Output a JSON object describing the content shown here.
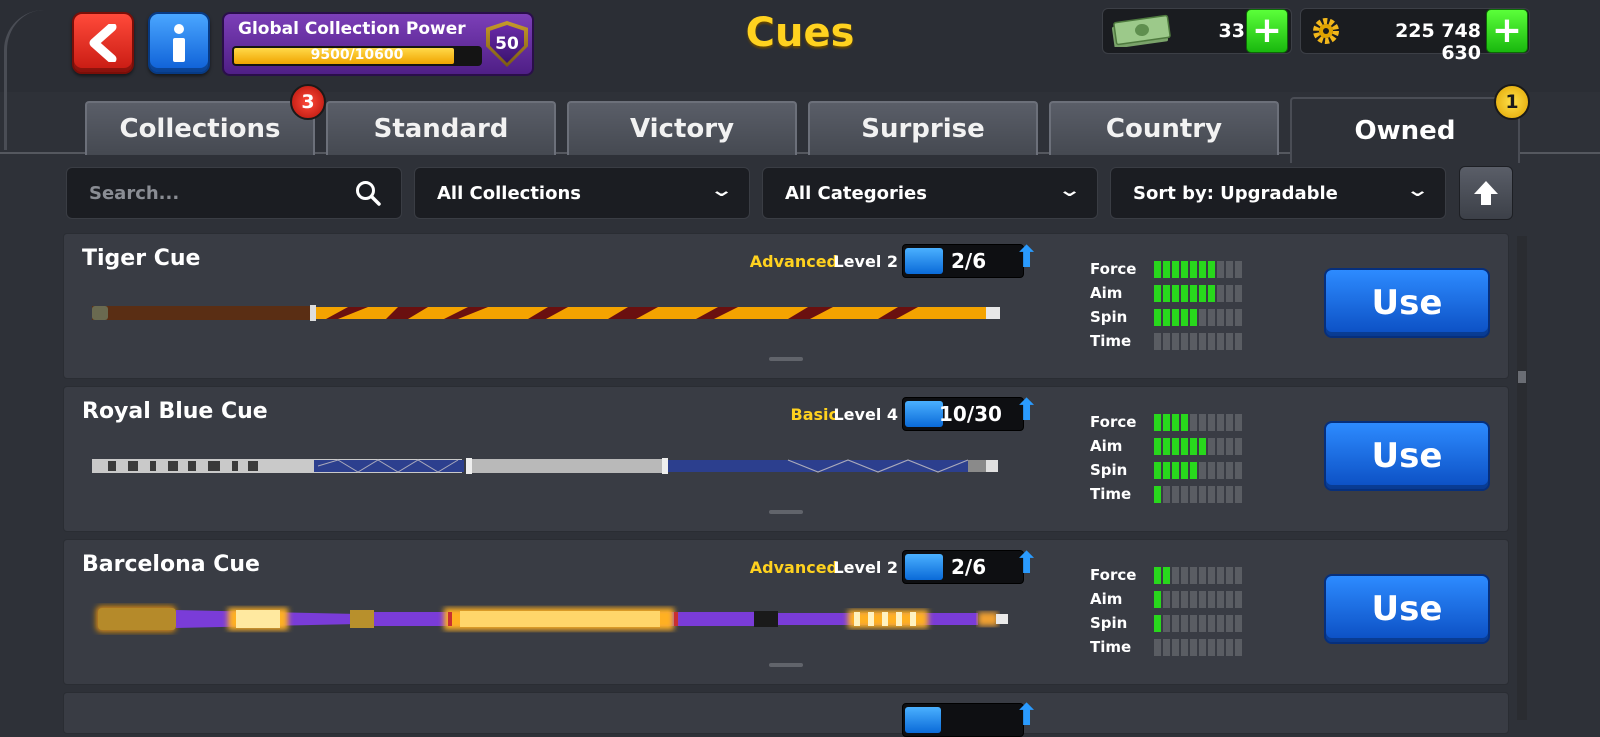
{
  "header": {
    "title": "Cues",
    "global_power": {
      "label": "Global Collection Power",
      "value": "9500/10600",
      "progress": 0.896,
      "level": "50"
    },
    "cash": "33",
    "coins": "225 748 630"
  },
  "tabs": [
    {
      "label": "Collections",
      "badge": "3"
    },
    {
      "label": "Standard"
    },
    {
      "label": "Victory"
    },
    {
      "label": "Surprise"
    },
    {
      "label": "Country"
    },
    {
      "label": "Owned",
      "badge": "1",
      "active": true
    }
  ],
  "filters": {
    "search_placeholder": "Search...",
    "collections": "All Collections",
    "categories": "All Categories",
    "sort": "Sort by: Upgradable"
  },
  "stat_labels": [
    "Force",
    "Aim",
    "Spin",
    "Time"
  ],
  "cues": [
    {
      "name": "Tiger Cue",
      "rarity": "Advanced",
      "level": "Level 2",
      "progress": "2/6",
      "fill": 0.33,
      "stats": [
        7,
        7,
        5,
        0
      ],
      "button": "Use"
    },
    {
      "name": "Royal Blue Cue",
      "rarity": "Basic",
      "level": "Level 4",
      "progress": "10/30",
      "fill": 0.33,
      "stats": [
        4,
        6,
        5,
        1
      ],
      "button": "Use"
    },
    {
      "name": "Barcelona Cue",
      "rarity": "Advanced",
      "level": "Level 2",
      "progress": "2/6",
      "fill": 0.33,
      "stats": [
        2,
        1,
        1,
        0
      ],
      "button": "Use"
    }
  ],
  "colors": {
    "accent": "#ffd21f",
    "use_button": "#1565e0",
    "stat_on": "#28d81c"
  }
}
